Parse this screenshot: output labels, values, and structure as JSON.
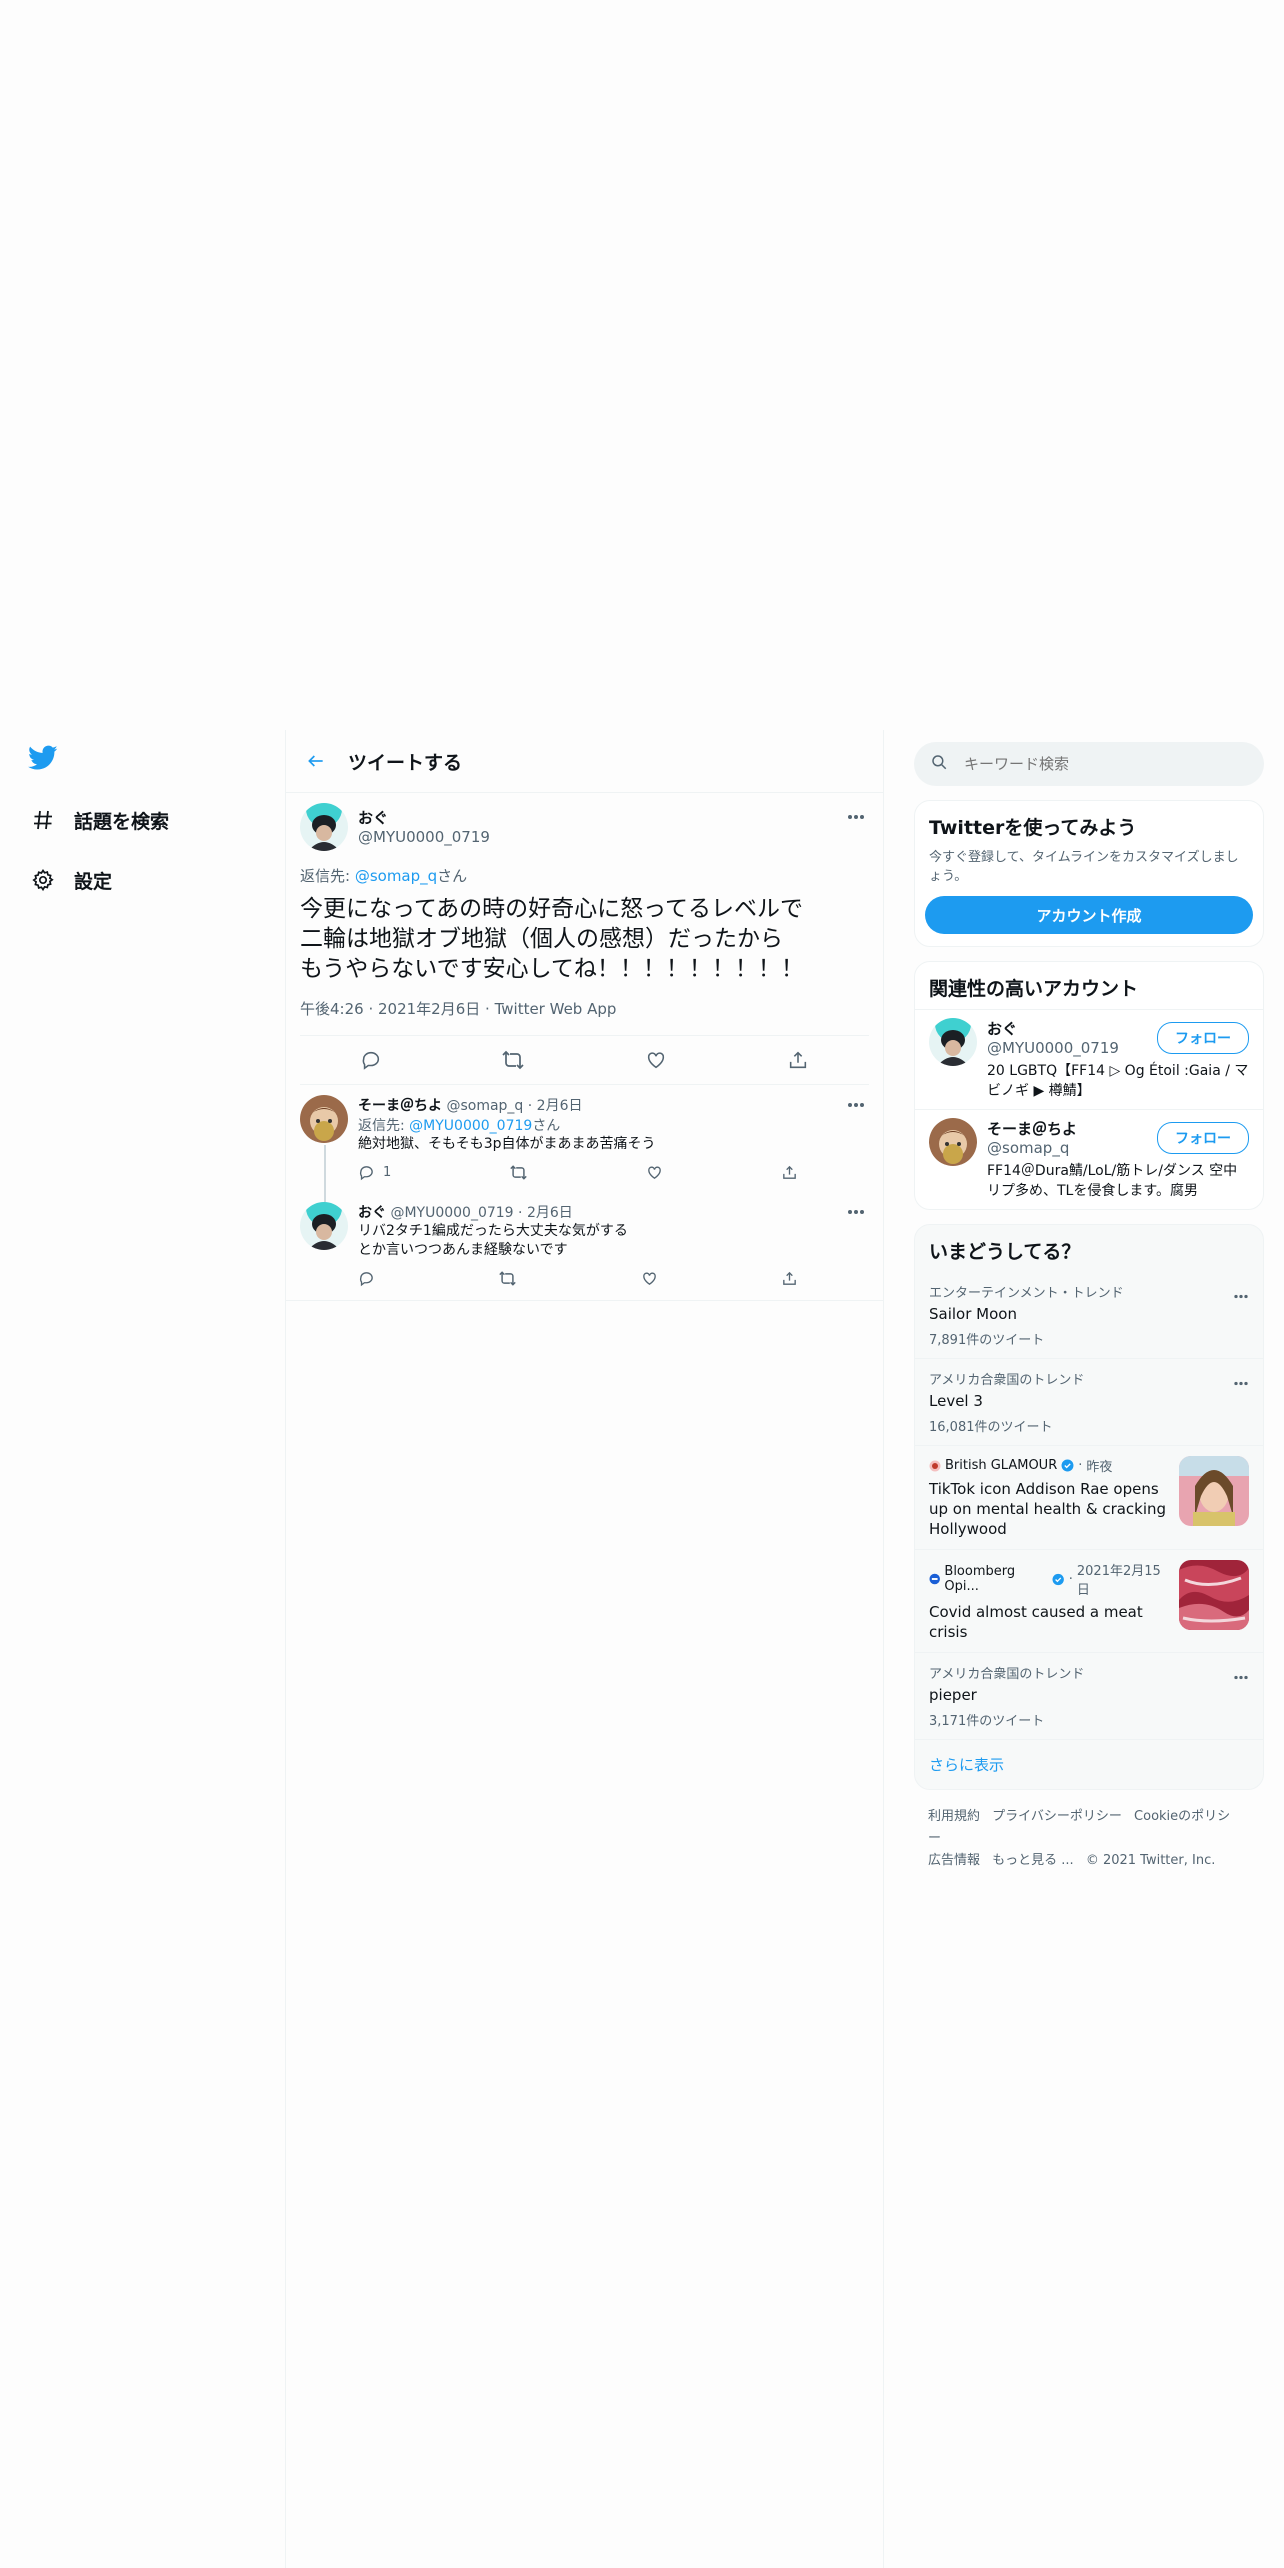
{
  "nav": {
    "items": [
      {
        "label": "話題を検索",
        "icon": "hashtag-icon"
      },
      {
        "label": "設定",
        "icon": "gear-icon"
      }
    ]
  },
  "header": {
    "title": "ツイートする"
  },
  "tweet": {
    "name": "おぐ",
    "handle": "@MYU0000_0719",
    "reply_prefix": "返信先: ",
    "reply_handle": "@somap_q",
    "reply_suffix": "さん",
    "text": "今更になってあの時の好奇心に怒ってるレベルで\n二輪は地獄オブ地獄（個人の感想）だったから\nもうやらないです安心してね！！！！！！！！！",
    "time": "午後4:26",
    "date": "2021年2月6日",
    "client": "Twitter Web App"
  },
  "replies": [
    {
      "name": "そーま＠ちよ",
      "handle": "@somap_q",
      "date": "2月6日",
      "reply_prefix": "返信先: ",
      "reply_handle": "@MYU0000_0719",
      "reply_suffix": "さん",
      "text": "絶対地獄、そもそも3p自体がまあまあ苦痛そう",
      "reply_count": "1"
    },
    {
      "name": "おぐ",
      "handle": "@MYU0000_0719",
      "date": "2月6日",
      "text": "リバ2タチ1編成だったら大丈夫な気がする\nとか言いつつあんま経験ないです",
      "reply_count": ""
    }
  ],
  "search": {
    "placeholder": "キーワード検索"
  },
  "signup": {
    "title": "Twitterを使ってみよう",
    "desc": "今すぐ登録して、タイムラインをカスタマイズしましょう。",
    "button": "アカウント作成"
  },
  "related": {
    "title": "関連性の高いアカウント",
    "follow_label": "フォロー",
    "accounts": [
      {
        "name": "おぐ",
        "handle": "@MYU0000_0719",
        "bio": "20 LGBTQ【FF14 ▷ Og Étoil :Gaia / マビノギ ▶ 樽鯖】"
      },
      {
        "name": "そーま＠ちよ",
        "handle": "@somap_q",
        "bio": "FF14＠Dura鯖/LoL/筋トレ/ダンス 空中リプ多め、TLを侵食します。腐男"
      }
    ]
  },
  "trends": {
    "title": "いまどうしてる？",
    "items": [
      {
        "context": "エンターテインメント・トレンド",
        "name": "Sailor Moon",
        "count": "7,891件のツイート"
      },
      {
        "context": "アメリカ合衆国のトレンド",
        "name": "Level 3",
        "count": "16,081件のツイート"
      }
    ],
    "news": [
      {
        "source": "British GLAMOUR",
        "time": "昨夜",
        "title": "TikTok icon Addison Rae opens up on mental health & cracking Hollywood"
      },
      {
        "source": "Bloomberg Opi...",
        "time": "2021年2月15日",
        "title": "Covid almost caused a meat crisis"
      }
    ],
    "last": {
      "context": "アメリカ合衆国のトレンド",
      "name": "pieper",
      "count": "3,171件のツイート"
    },
    "show_more": "さらに表示"
  },
  "footer": {
    "links": [
      "利用規約",
      "プライバシーポリシー",
      "Cookieのポリシー",
      "広告情報",
      "もっと見る ..."
    ],
    "copyright": "© 2021 Twitter, Inc."
  },
  "colors": {
    "accent": "#1d9bf0",
    "text": "#0f1419",
    "muted": "#536471",
    "border": "#eff3f4"
  }
}
